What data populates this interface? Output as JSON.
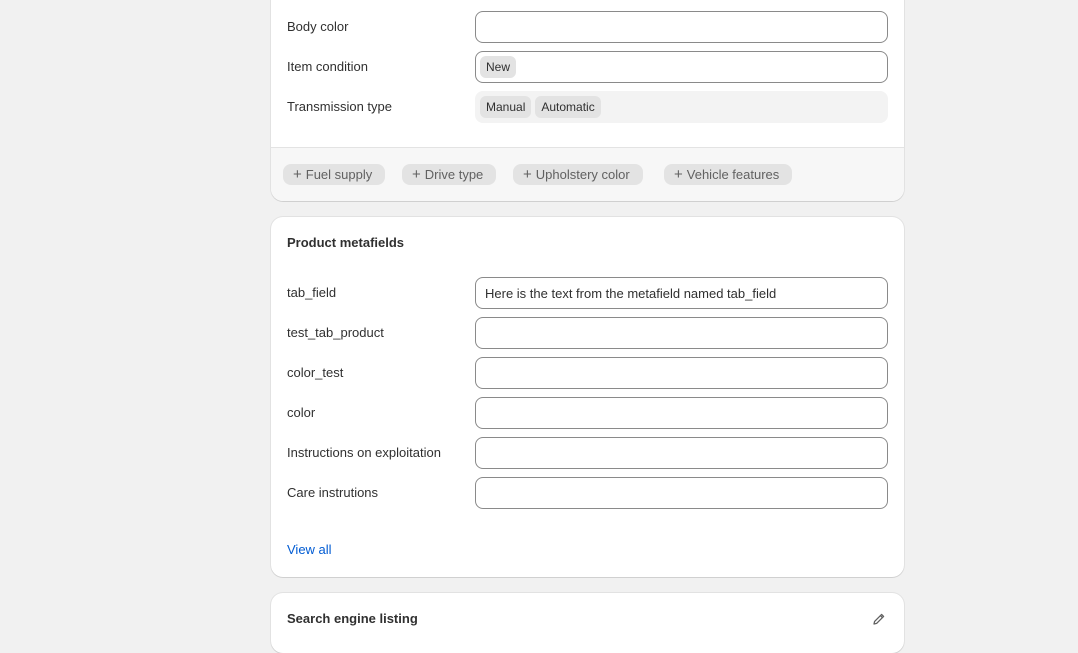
{
  "attributes": {
    "rows": [
      {
        "label": "Body color",
        "value": "",
        "tags": []
      },
      {
        "label": "Item condition",
        "value": "",
        "tags": [
          "New"
        ]
      },
      {
        "label": "Transmission type",
        "value": "",
        "tags": [
          "Manual",
          "Automatic"
        ]
      }
    ],
    "add_chips": [
      "Fuel supply",
      "Drive type",
      "Upholstery color",
      "Vehicle features"
    ]
  },
  "metafields": {
    "title": "Product metafields",
    "rows": [
      {
        "label": "tab_field",
        "value": "Here is the text from the metafield named tab_field"
      },
      {
        "label": "test_tab_product",
        "value": ""
      },
      {
        "label": "color_test",
        "value": ""
      },
      {
        "label": "color",
        "value": ""
      },
      {
        "label": "Instructions on exploitation",
        "value": ""
      },
      {
        "label": "Care instrutions",
        "value": ""
      }
    ],
    "view_all": "View all"
  },
  "seo": {
    "title": "Search engine listing",
    "edit_icon": "pencil-icon"
  },
  "colors": {
    "link": "#005bd3",
    "page_bg": "#f1f1f1",
    "tag_bg": "#e3e3e3"
  }
}
